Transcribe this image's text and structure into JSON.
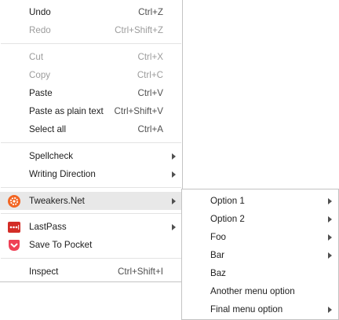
{
  "main_menu": {
    "undo": {
      "label": "Undo",
      "shortcut": "Ctrl+Z"
    },
    "redo": {
      "label": "Redo",
      "shortcut": "Ctrl+Shift+Z"
    },
    "cut": {
      "label": "Cut",
      "shortcut": "Ctrl+X"
    },
    "copy": {
      "label": "Copy",
      "shortcut": "Ctrl+C"
    },
    "paste": {
      "label": "Paste",
      "shortcut": "Ctrl+V"
    },
    "paste_plain": {
      "label": "Paste as plain text",
      "shortcut": "Ctrl+Shift+V"
    },
    "select_all": {
      "label": "Select all",
      "shortcut": "Ctrl+A"
    },
    "spellcheck": {
      "label": "Spellcheck"
    },
    "writing_direction": {
      "label": "Writing Direction"
    },
    "tweakers": {
      "label": "Tweakers.Net",
      "icon": "tweakers-gear-icon",
      "icon_color": "#f26522"
    },
    "lastpass": {
      "label": "LastPass",
      "icon": "lastpass-icon",
      "icon_color": "#d32d27"
    },
    "pocket": {
      "label": "Save To Pocket",
      "icon": "pocket-icon",
      "icon_color": "#ef4056"
    },
    "inspect": {
      "label": "Inspect",
      "shortcut": "Ctrl+Shift+I"
    }
  },
  "sub_menu": {
    "option1": {
      "label": "Option 1"
    },
    "option2": {
      "label": "Option 2"
    },
    "foo": {
      "label": "Foo"
    },
    "bar": {
      "label": "Bar"
    },
    "baz": {
      "label": "Baz"
    },
    "another": {
      "label": "Another menu option"
    },
    "final": {
      "label": "Final menu option"
    }
  },
  "colors": {
    "highlight": "#e8e8e8",
    "disabled_text": "#9c9c9c",
    "separator": "#e3e3e3",
    "border": "#c3c3c3"
  }
}
